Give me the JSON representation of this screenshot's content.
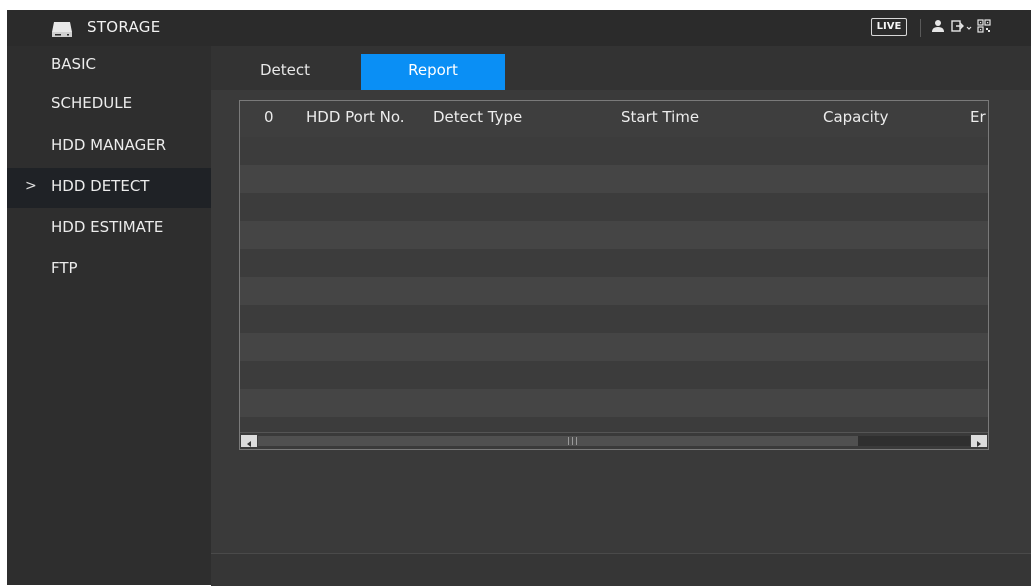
{
  "header": {
    "title": "STORAGE",
    "live_label": "LIVE",
    "icons": [
      "storage-drive-icon",
      "user-icon",
      "logout-icon",
      "qr-code-icon"
    ]
  },
  "sidebar": {
    "items": [
      {
        "label": "BASIC",
        "active": false
      },
      {
        "label": "SCHEDULE",
        "active": false
      },
      {
        "label": "HDD MANAGER",
        "active": false
      },
      {
        "label": "HDD DETECT",
        "active": true
      },
      {
        "label": "HDD ESTIMATE",
        "active": false
      },
      {
        "label": "FTP",
        "active": false
      }
    ],
    "active_marker": ">"
  },
  "tabs": [
    {
      "label": "Detect",
      "active": false
    },
    {
      "label": "Report",
      "active": true
    }
  ],
  "table": {
    "columns": [
      "0",
      "HDD Port No.",
      "Detect Type",
      "Start Time",
      "Capacity",
      "Er"
    ],
    "rows": []
  },
  "colors": {
    "accent": "#0a8ff5",
    "sidebar_bg": "#2e2e2e",
    "content_bg": "#3a3a3a"
  }
}
